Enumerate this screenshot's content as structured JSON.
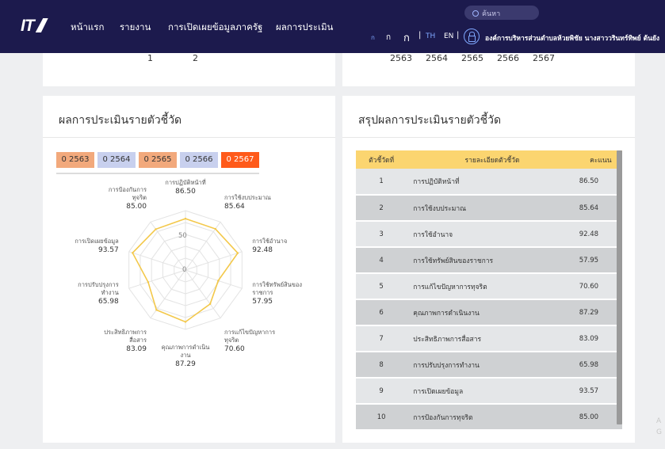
{
  "nav": {
    "logo": "IT",
    "links": [
      "หน้าแรก",
      "รายงาน",
      "การเปิดเผยข้อมูลภาครัฐ",
      "ผลการประเมิน"
    ],
    "search_label": "ค้นหา",
    "font_sizes": [
      "ก",
      "ก",
      "ก"
    ],
    "lang_th": "TH",
    "lang_en": "EN",
    "separator": "|",
    "org_name": "องค์การบริหารส่วนตำบลห้วยพิชัย นางสาววรินทร์ทิพย์ ต้นยัง"
  },
  "top_left_pages": [
    "1",
    "2"
  ],
  "top_right_years": [
    "2563",
    "2564",
    "2565",
    "2566",
    "2567"
  ],
  "eval": {
    "title": "ผลการประเมินรายตัวชี้วัด",
    "year_tabs": [
      "2563",
      "2564",
      "2565",
      "2566",
      "2567"
    ],
    "tab_prefix": "0",
    "tab_colors": [
      "#f2a97c",
      "#c8d0ee",
      "#f2a97c",
      "#c8d0ee",
      "#ff5a1a"
    ],
    "tab_text_colors": [
      "#333333",
      "#333333",
      "#333333",
      "#333333",
      "#ffffff"
    ],
    "radar_ticks": [
      "50",
      "0"
    ],
    "radar_color": "#f3c84a"
  },
  "chart_data": {
    "type": "radar",
    "max": 100,
    "ticks": [
      0,
      50,
      100
    ],
    "categories": [
      "การปฏิบัติหน้าที่",
      "การใช้งบประมาณ",
      "การใช้อำนาจ",
      "การใช้ทรัพย์สินของราชการ",
      "การแก้ไขปัญหาการทุจริต",
      "คุณภาพการดำเนินงาน",
      "ประสิทธิภาพการสื่อสาร",
      "การปรับปรุงการทำงาน",
      "การเปิดเผยข้อมูล",
      "การป้องกันการทุจริต"
    ],
    "label_lines": [
      [
        "การปฏิบัติหน้าที่"
      ],
      [
        "การใช้งบประมาณ"
      ],
      [
        "การใช้อำนาจ"
      ],
      [
        "การใช้ทรัพย์สินของ",
        "ราชการ"
      ],
      [
        "การแก้ไขปัญหาการ",
        "ทุจริต"
      ],
      [
        "คุณภาพการดำเนิน",
        "งาน"
      ],
      [
        "ประสิทธิภาพการ",
        "สื่อสาร"
      ],
      [
        "การปรับปรุงการ",
        "ทำงาน"
      ],
      [
        "การเปิดเผยข้อมูล"
      ],
      [
        "การป้องกันการ",
        "ทุจริต"
      ]
    ],
    "values": [
      86.5,
      85.64,
      92.48,
      57.95,
      70.6,
      87.29,
      83.09,
      65.98,
      93.57,
      85.0
    ],
    "value_labels": [
      "86.50",
      "85.64",
      "92.48",
      "57.95",
      "70.60",
      "87.29",
      "83.09",
      "65.98",
      "93.57",
      "85.00"
    ]
  },
  "summary": {
    "title": "สรุปผลการประเมินรายตัวชี้วัด",
    "headers": [
      "ตัวชี้วัดที่",
      "รายละเอียดตัวชี้วัด",
      "คะแนน"
    ],
    "rows": [
      [
        "1",
        "การปฏิบัติหน้าที่",
        "86.50"
      ],
      [
        "2",
        "การใช้งบประมาณ",
        "85.64"
      ],
      [
        "3",
        "การใช้อำนาจ",
        "92.48"
      ],
      [
        "4",
        "การใช้ทรัพย์สินของราชการ",
        "57.95"
      ],
      [
        "5",
        "การแก้ไขปัญหาการทุจริต",
        "70.60"
      ],
      [
        "6",
        "คุณภาพการดำเนินงาน",
        "87.29"
      ],
      [
        "7",
        "ประสิทธิภาพการสื่อสาร",
        "83.09"
      ],
      [
        "8",
        "การปรับปรุงการทำงาน",
        "65.98"
      ],
      [
        "9",
        "การเปิดเผยข้อมูล",
        "93.57"
      ],
      [
        "10",
        "การป้องกันการทุจริต",
        "85.00"
      ]
    ]
  },
  "side_faint": [
    "A",
    "G"
  ]
}
